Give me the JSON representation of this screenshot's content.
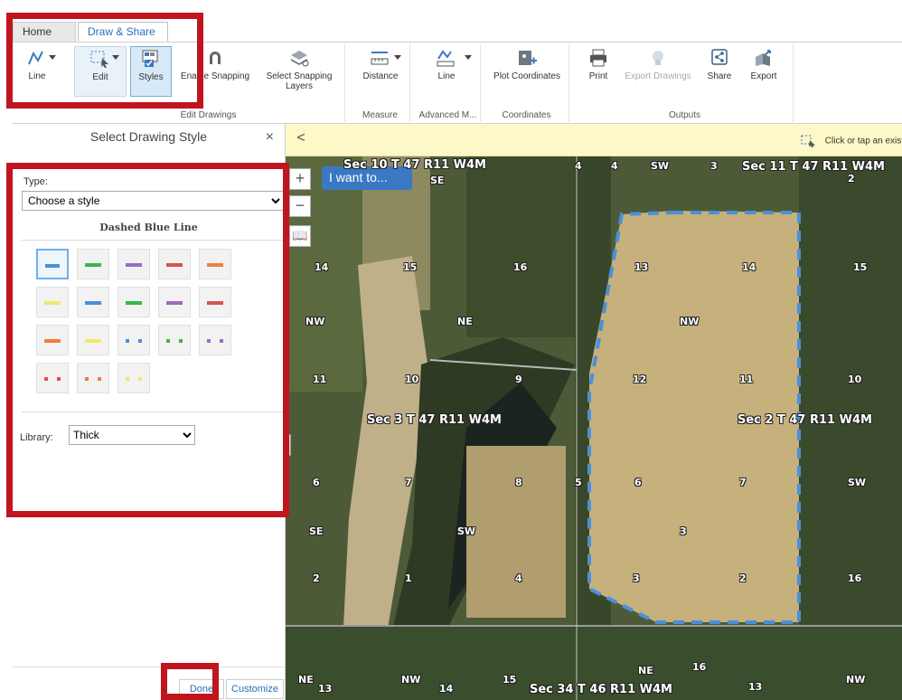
{
  "tabs": [
    {
      "label": "Home"
    },
    {
      "label": "Draw & Share"
    }
  ],
  "ribbon": {
    "line_label": "Line",
    "edit_label": "Edit",
    "styles_label": "Styles",
    "enable_snapping_label": "Enable Snapping",
    "select_snapping_label": "Select Snapping Layers",
    "edit_group_label": "Edit Drawings",
    "distance_label": "Distance",
    "measure_group_label": "Measure",
    "adv_line_label": "Line",
    "advanced_group_label": "Advanced M...",
    "plot_coords_label": "Plot Coordinates",
    "coords_group_label": "Coordinates",
    "print_label": "Print",
    "export_drawings_label": "Export Drawings",
    "share_label": "Share",
    "export_label": "Export",
    "outputs_group_label": "Outputs"
  },
  "panel": {
    "title": "Select Drawing Style",
    "close": "×",
    "type_label": "Type:",
    "type_value": "Choose a style",
    "style_name": "Dashed Blue Line",
    "library_label": "Library:",
    "library_value": "Thick",
    "done_label": "Done",
    "customize_label": "Customize",
    "swatches": [
      {
        "color": "#4a90d9",
        "style": "solid",
        "selected": true
      },
      {
        "color": "#3cb54a",
        "style": "solid"
      },
      {
        "color": "#9b6bc4",
        "style": "solid"
      },
      {
        "color": "#d9534f",
        "style": "solid"
      },
      {
        "color": "#ee8034",
        "style": "solid"
      },
      {
        "color": "#f5e66a",
        "style": "solid"
      },
      {
        "color": "#4a90d9",
        "style": "solid"
      },
      {
        "color": "#3cb54a",
        "style": "solid"
      },
      {
        "color": "#9b6bc4",
        "style": "solid"
      },
      {
        "color": "#d9534f",
        "style": "solid"
      },
      {
        "color": "#ee8034",
        "style": "solid"
      },
      {
        "color": "#f5e66a",
        "style": "solid"
      },
      {
        "color": "#4a90d9",
        "style": "dashed"
      },
      {
        "color": "#3cb54a",
        "style": "dashed"
      },
      {
        "color": "#9b6bc4",
        "style": "dashed"
      },
      {
        "color": "#d9534f",
        "style": "dashed"
      },
      {
        "color": "#ee8034",
        "style": "dashed"
      },
      {
        "color": "#f5e66a",
        "style": "dashed"
      }
    ]
  },
  "map": {
    "collapse": "<",
    "hint": "Click or tap an existing",
    "zoom_in": "+",
    "zoom_out": "−",
    "i_want_to": "I want to...",
    "labels": [
      {
        "text": "Sec 10 T 47 R11 W4M",
        "big": true
      },
      {
        "text": "SE"
      },
      {
        "text": "4"
      },
      {
        "text": "4"
      },
      {
        "text": "SW"
      },
      {
        "text": "3"
      },
      {
        "text": "Sec 11 T 47 R11 W4M",
        "big": true
      },
      {
        "text": "2"
      },
      {
        "text": "14"
      },
      {
        "text": "15"
      },
      {
        "text": "16"
      },
      {
        "text": "13"
      },
      {
        "text": "14"
      },
      {
        "text": "15"
      },
      {
        "text": "NW"
      },
      {
        "text": "NE"
      },
      {
        "text": "NW"
      },
      {
        "text": "11"
      },
      {
        "text": "10"
      },
      {
        "text": "9"
      },
      {
        "text": "12"
      },
      {
        "text": "11"
      },
      {
        "text": "10"
      },
      {
        "text": "Sec 3 T 47 R11 W4M",
        "big": true
      },
      {
        "text": "Sec 2 T 47 R11 W4M",
        "big": true
      },
      {
        "text": "6"
      },
      {
        "text": "7"
      },
      {
        "text": "8"
      },
      {
        "text": "5"
      },
      {
        "text": "6"
      },
      {
        "text": "7"
      },
      {
        "text": "SW"
      },
      {
        "text": "SE"
      },
      {
        "text": "SW"
      },
      {
        "text": "3"
      },
      {
        "text": "2"
      },
      {
        "text": "1"
      },
      {
        "text": "4"
      },
      {
        "text": "3"
      },
      {
        "text": "2"
      },
      {
        "text": "16"
      },
      {
        "text": "NE"
      },
      {
        "text": "13"
      },
      {
        "text": "NW"
      },
      {
        "text": "14"
      },
      {
        "text": "15"
      },
      {
        "text": "Sec 34 T 46 R11 W4M",
        "big": true
      },
      {
        "text": "NE"
      },
      {
        "text": "16"
      },
      {
        "text": "13"
      },
      {
        "text": "NW"
      }
    ]
  },
  "colors": {
    "accent": "#2a6ebd",
    "annotation_red": "#c0141e",
    "drawn_line_blue": "#4a90d9"
  }
}
